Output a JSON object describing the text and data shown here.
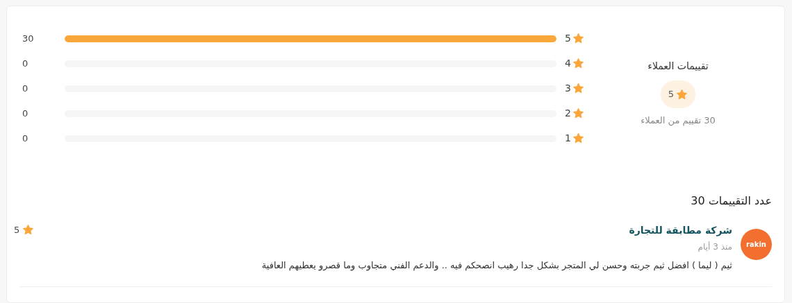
{
  "summary": {
    "title": "تقييمات العملاء",
    "average": "5",
    "caption": "30 تقييم من العملاء"
  },
  "breakdown": [
    {
      "stars_label": "5",
      "level": 1,
      "count": "30"
    },
    {
      "stars_label": "4",
      "level": 0,
      "count": "0"
    },
    {
      "stars_label": "3",
      "level": 0,
      "count": "0"
    },
    {
      "stars_label": "2",
      "level": 0,
      "count": "0"
    },
    {
      "stars_label": "1",
      "level": 0,
      "count": "0"
    }
  ],
  "reviews_heading": "عدد التقييمات 30",
  "reviews": [
    {
      "avatar_text": "rakin",
      "author": "شركة مطابقة للتجارة",
      "time": "منذ 3 أيام",
      "text": "ثيم ( ليما ) افضل ثيم جربته وحسن لي المتجر بشكل جدا رهيب انصحكم فيه .. والدعم الفني متجاوب وما قصرو يعطيهم العافية",
      "rating": "5"
    }
  ]
}
